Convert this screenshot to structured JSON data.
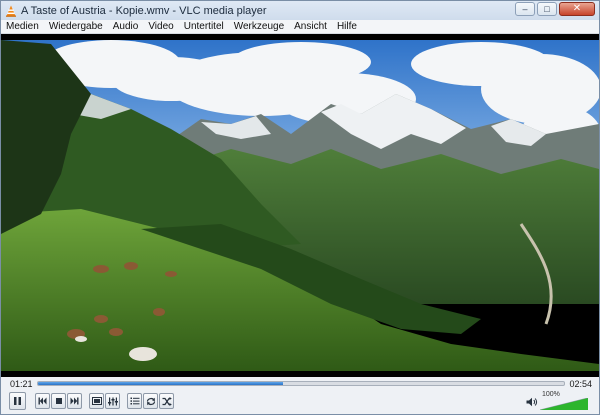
{
  "window": {
    "title": "A Taste of Austria - Kopie.wmv - VLC media player",
    "app_icon": "vlc-cone-icon",
    "controls": {
      "minimize": "–",
      "maximize": "□",
      "close": "✕"
    }
  },
  "menu": {
    "items": [
      "Medien",
      "Wiedergabe",
      "Audio",
      "Video",
      "Untertitel",
      "Werkzeuge",
      "Ansicht",
      "Hilfe"
    ]
  },
  "player": {
    "elapsed": "01:21",
    "total": "02:54",
    "progress_fraction": 0.465,
    "volume_label": "100%",
    "volume_fraction": 1.0,
    "buttons": [
      {
        "name": "play-button",
        "icon": "play-icon"
      },
      {
        "name": "previous-button",
        "icon": "skip-back-icon"
      },
      {
        "name": "stop-button",
        "icon": "stop-icon"
      },
      {
        "name": "next-button",
        "icon": "skip-forward-icon"
      },
      {
        "name": "fullscreen-button",
        "icon": "fullscreen-icon"
      },
      {
        "name": "extended-settings-button",
        "icon": "equalizer-icon"
      },
      {
        "name": "playlist-button",
        "icon": "playlist-icon"
      },
      {
        "name": "loop-button",
        "icon": "loop-icon"
      },
      {
        "name": "shuffle-button",
        "icon": "shuffle-icon"
      }
    ]
  },
  "colors": {
    "accent": "#2a73c6",
    "volume_green": "#2db52d"
  }
}
